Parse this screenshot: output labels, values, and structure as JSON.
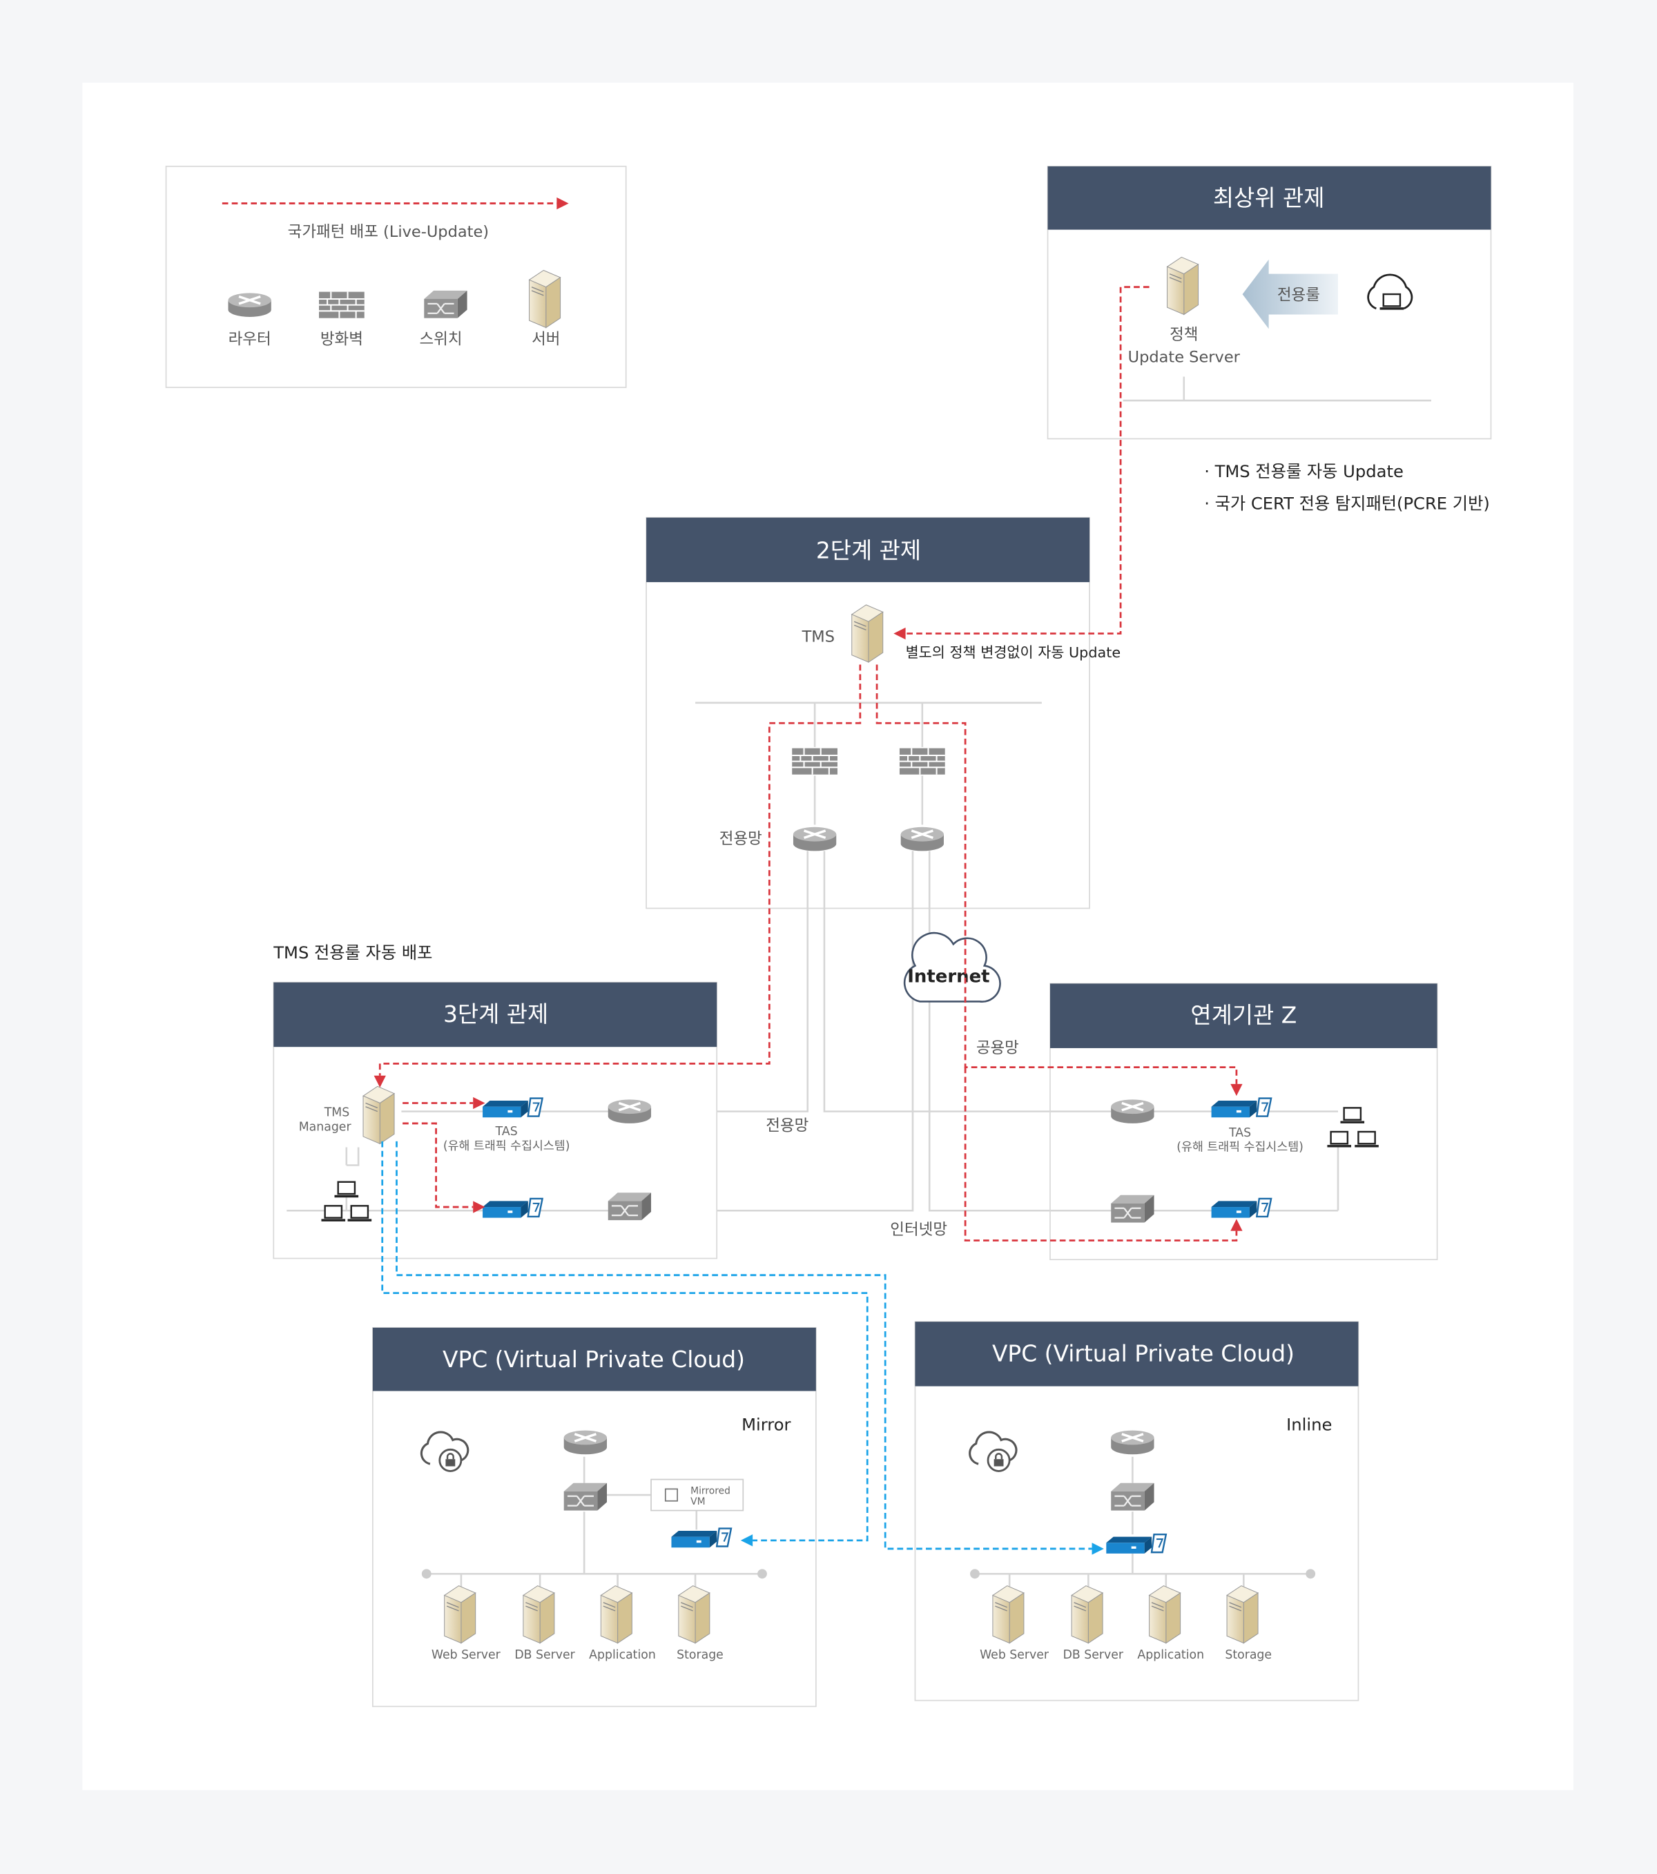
{
  "legend": {
    "arrow_label": "국가패턴 배포 (Live-Update)",
    "items": [
      {
        "icon": "router-icon",
        "label": "라우터"
      },
      {
        "icon": "firewall-icon",
        "label": "방화벽"
      },
      {
        "icon": "switch-icon",
        "label": "스위치"
      },
      {
        "icon": "server-icon",
        "label": "서버"
      }
    ]
  },
  "top": {
    "title": "최상위 관제",
    "server_label_1": "정책",
    "server_label_2": "Update Server",
    "arrow_label": "전용룰",
    "notes": [
      "· TMS 전용룰 자동 Update",
      "· 국가 CERT 전용 탐지패턴(PCRE 기반)"
    ]
  },
  "stage2": {
    "title": "2단계 관제",
    "tms_label": "TMS",
    "update_note": "별도의 정책 변경없이 자동 Update",
    "network_label": "전용망"
  },
  "internet": {
    "label": "Internet",
    "public_label": "공용망",
    "private_label": "전용망",
    "internet_label": "인터넷망"
  },
  "stage3": {
    "caption": "TMS 전용룰 자동 배포",
    "title": "3단계 관제",
    "manager_label_1": "TMS",
    "manager_label_2": "Manager",
    "tas_label_1": "TAS",
    "tas_label_2": "(유해 트래픽 수집시스템)"
  },
  "partner": {
    "title": "연계기관 Z",
    "tas_label_1": "TAS",
    "tas_label_2": "(유해 트래픽 수집시스템)"
  },
  "vpc_mirror": {
    "title": "VPC (Virtual Private Cloud)",
    "mode": "Mirror",
    "vm_label_1": "Mirrored",
    "vm_label_2": "VM",
    "servers": [
      "Web Server",
      "DB Server",
      "Application",
      "Storage"
    ]
  },
  "vpc_inline": {
    "title": "VPC (Virtual Private Cloud)",
    "mode": "Inline",
    "servers": [
      "Web Server",
      "DB Server",
      "Application",
      "Storage"
    ]
  },
  "colors": {
    "header": "#44536a",
    "policy_flow": "#d9363e",
    "cloud_flow": "#1aa3e8",
    "tas": "#1a75b8"
  }
}
